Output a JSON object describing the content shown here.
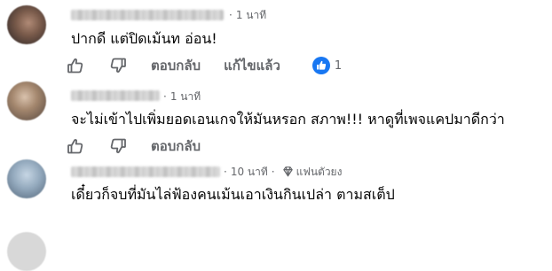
{
  "comments": [
    {
      "time": "1 นาที",
      "text": "ปากดี แต่ปิดเม้นท อ่อน!",
      "reply_label": "ตอบกลับ",
      "edit_label": "แก้ไขแล้ว",
      "reaction_count": "1"
    },
    {
      "time": "1 นาที",
      "text": "จะไม่เข้าไปเพิ่มยอดเอนเกจให้มันหรอก สภาพ!!! หาดูที่เพจแคปมาดีกว่า",
      "reply_label": "ตอบกลับ"
    },
    {
      "time": "10 นาที",
      "badge": "แฟนตัวยง",
      "text": "เดี๋ยวก็จบที่มันไล่ฟ้องคนเม้นเอาเงินกินเปล่า ตามสเต็ป"
    }
  ],
  "colors": {
    "text": "#050505",
    "secondary": "#65676b",
    "like_blue": "#1877f2"
  },
  "icons": {
    "like": "thumbs-up-icon",
    "dislike": "thumbs-down-icon",
    "badge": "diamond-icon"
  }
}
